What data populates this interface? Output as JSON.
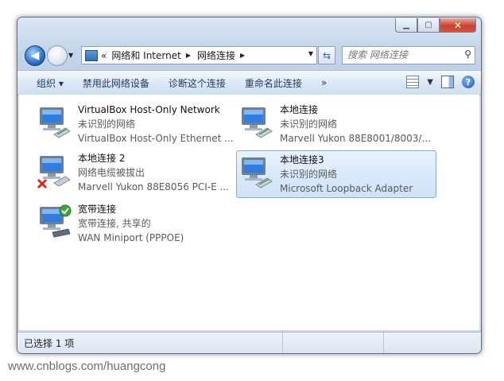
{
  "breadcrumb": [
    "«",
    "网络和 Internet",
    "网络连接"
  ],
  "search": {
    "placeholder": "搜索 网络连接"
  },
  "toolbar": {
    "organize": "组织 ▾",
    "disable": "禁用此网络设备",
    "diagnose": "诊断这个连接",
    "rename": "重命名此连接",
    "more": "»"
  },
  "connections": [
    {
      "name": "VirtualBox Host-Only Network",
      "status": "未识别的网络",
      "device": "VirtualBox Host-Only Ethernet ...",
      "icon": "network-computer-icon"
    },
    {
      "name": "本地连接",
      "status": "未识别的网络",
      "device": "Marvell Yukon 88E8001/8003/...",
      "icon": "network-computer-icon"
    },
    {
      "name": "本地连接 2",
      "status": "网络电缆被拔出",
      "device": "Marvell Yukon 88E8056 PCI-E ...",
      "icon": "network-disconnected-icon"
    },
    {
      "name": "本地连接3",
      "status": "未识别的网络",
      "device": "Microsoft Loopback Adapter",
      "icon": "network-computer-icon",
      "selected": true
    },
    {
      "name": "宽带连接",
      "status": "宽带连接, 共享的",
      "device": "WAN Miniport (PPPOE)",
      "icon": "broadband-connected-icon"
    }
  ],
  "status_bar": {
    "selection": "已选择 1 项"
  },
  "watermark": "www.cnblogs.com/huangcong",
  "colors": {
    "selection_bg": "#cde2f8",
    "selection_border": "#84acdd",
    "toolbar_text": "#1e395b"
  }
}
